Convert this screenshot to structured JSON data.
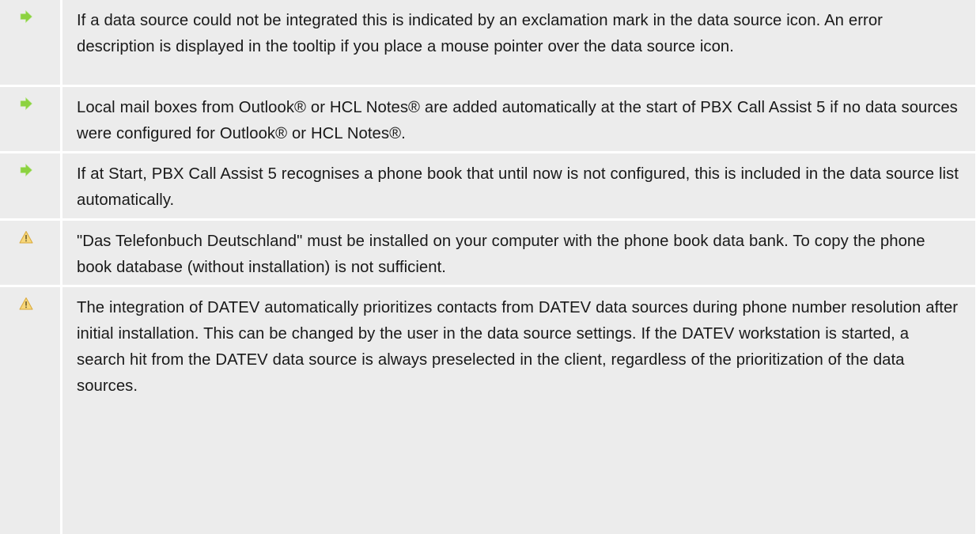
{
  "colors": {
    "background": "#ececec",
    "separator": "#ffffff",
    "text": "#1a1a1a",
    "arrow_icon": "#8cd240",
    "warning_icon": "#f2c85a"
  },
  "notes": [
    {
      "icon": "green-arrow-right-icon",
      "text": "If a data source could not be integrated this is indicated by an exclamation mark in the data source icon. An error description is displayed in the tooltip if you place a mouse pointer over the data source icon."
    },
    {
      "icon": "green-arrow-right-icon",
      "text": "Local mail boxes from Outlook® or HCL Notes® are added automatically at the start of PBX Call Assist 5 if no data sources were configured for Outlook® or HCL Notes®."
    },
    {
      "icon": "green-arrow-right-icon",
      "text": "If at Start, PBX Call Assist 5 recognises a phone book that until now is not configured, this is included in the data source list automatically."
    },
    {
      "icon": "warning-triangle-icon",
      "text": "\"Das Telefonbuch Deutschland\" must be installed on your computer with the phone book data bank. To copy the phone book database (without installation) is not sufficient."
    },
    {
      "icon": "warning-triangle-icon",
      "text": "The integration of DATEV automatically prioritizes contacts from DATEV data sources during phone number resolution after initial installation. This can be changed by the user in the data source settings. If the DATEV workstation is started, a search hit from the DATEV data source is always preselected in the client, regardless of the prioritization of the data sources."
    }
  ]
}
